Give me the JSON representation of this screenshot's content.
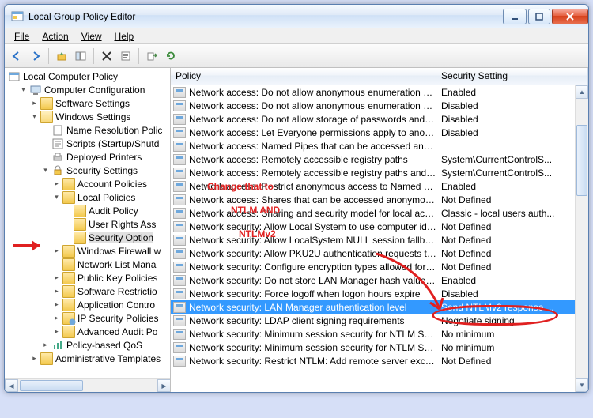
{
  "window": {
    "title": "Local Group Policy Editor"
  },
  "menu": {
    "file": "File",
    "action": "Action",
    "view": "View",
    "help": "Help"
  },
  "tree": {
    "root": "Local Computer Policy",
    "items": [
      {
        "indent": 1,
        "exp": "▾",
        "icon": "computer",
        "label": "Computer Configuration"
      },
      {
        "indent": 2,
        "exp": "▸",
        "icon": "folder",
        "label": "Software Settings"
      },
      {
        "indent": 2,
        "exp": "▾",
        "icon": "folder-open",
        "label": "Windows Settings"
      },
      {
        "indent": 3,
        "exp": "",
        "icon": "doc",
        "label": "Name Resolution Polic"
      },
      {
        "indent": 3,
        "exp": "",
        "icon": "script",
        "label": "Scripts (Startup/Shutd"
      },
      {
        "indent": 3,
        "exp": "",
        "icon": "printer",
        "label": "Deployed Printers"
      },
      {
        "indent": 3,
        "exp": "▾",
        "icon": "security",
        "label": "Security Settings"
      },
      {
        "indent": 4,
        "exp": "▸",
        "icon": "folder",
        "label": "Account Policies"
      },
      {
        "indent": 4,
        "exp": "▾",
        "icon": "folder",
        "label": "Local Policies"
      },
      {
        "indent": 5,
        "exp": "",
        "icon": "folder",
        "label": "Audit Policy"
      },
      {
        "indent": 5,
        "exp": "",
        "icon": "folder",
        "label": "User Rights Ass"
      },
      {
        "indent": 5,
        "exp": "",
        "icon": "folder",
        "label": "Security Option",
        "sel": true
      },
      {
        "indent": 4,
        "exp": "▸",
        "icon": "folder",
        "label": "Windows Firewall w"
      },
      {
        "indent": 4,
        "exp": "",
        "icon": "folder",
        "label": "Network List Mana"
      },
      {
        "indent": 4,
        "exp": "▸",
        "icon": "folder",
        "label": "Public Key Policies"
      },
      {
        "indent": 4,
        "exp": "▸",
        "icon": "folder",
        "label": "Software Restrictio"
      },
      {
        "indent": 4,
        "exp": "▸",
        "icon": "folder",
        "label": "Application Contro"
      },
      {
        "indent": 4,
        "exp": "▸",
        "icon": "folder-ip",
        "label": "IP Security Policies"
      },
      {
        "indent": 4,
        "exp": "▸",
        "icon": "folder",
        "label": "Advanced Audit Po"
      },
      {
        "indent": 3,
        "exp": "▸",
        "icon": "qos",
        "label": "Policy-based QoS"
      },
      {
        "indent": 2,
        "exp": "▸",
        "icon": "folder",
        "label": "Administrative Templates"
      },
      {
        "indent": 1,
        "exp": "",
        "icon": "",
        "label": ""
      }
    ]
  },
  "columns": {
    "policy": "Policy",
    "setting": "Security Setting"
  },
  "policies": [
    {
      "p": "Network access: Do not allow anonymous enumeration of S...",
      "s": "Enabled"
    },
    {
      "p": "Network access: Do not allow anonymous enumeration of S...",
      "s": "Disabled"
    },
    {
      "p": "Network access: Do not allow storage of passwords and cre...",
      "s": "Disabled"
    },
    {
      "p": "Network access: Let Everyone permissions apply to anonym...",
      "s": "Disabled"
    },
    {
      "p": "Network access: Named Pipes that can be accessed anonym...",
      "s": ""
    },
    {
      "p": "Network access: Remotely accessible registry paths",
      "s": "System\\CurrentControlS..."
    },
    {
      "p": "Network access: Remotely accessible registry paths and sub...",
      "s": "System\\CurrentControlS..."
    },
    {
      "p": "Network access: Restrict anonymous access to Named Pipes ...",
      "s": "Enabled"
    },
    {
      "p": "Network access: Shares that can be accessed anonymously",
      "s": "Not Defined"
    },
    {
      "p": "Network access: Sharing and security model for local accou...",
      "s": "Classic - local users auth..."
    },
    {
      "p": "Network security: Allow Local System to use computer ident...",
      "s": "Not Defined"
    },
    {
      "p": "Network security: Allow LocalSystem NULL session fallback",
      "s": "Not Defined"
    },
    {
      "p": "Network security: Allow PKU2U authentication requests to t...",
      "s": "Not Defined"
    },
    {
      "p": "Network security: Configure encryption types allowed for Ke...",
      "s": "Not Defined"
    },
    {
      "p": "Network security: Do not store LAN Manager hash value on ...",
      "s": "Enabled"
    },
    {
      "p": "Network security: Force logoff when logon hours expire",
      "s": "Disabled"
    },
    {
      "p": "Network security: LAN Manager authentication level",
      "s": "Send NTLMv2 response ...",
      "sel": true
    },
    {
      "p": "Network security: LDAP client signing requirements",
      "s": "Negotiate signing"
    },
    {
      "p": "Network security: Minimum session security for NTLM SSP ...",
      "s": "No minimum"
    },
    {
      "p": "Network security: Minimum session security for NTLM SSP ...",
      "s": "No minimum"
    },
    {
      "p": "Network security: Restrict NTLM: Add remote server excepti...",
      "s": "Not Defined"
    }
  ],
  "annotation": {
    "line1": "Change that to",
    "line2": "NTLM AND",
    "line3": "NTLMv2"
  }
}
